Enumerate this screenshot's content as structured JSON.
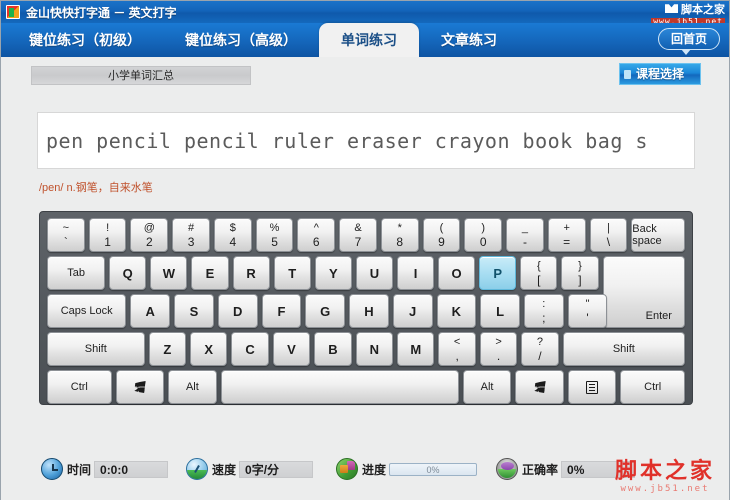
{
  "window": {
    "title": "金山快快打字通 － 英文打字",
    "app_icon": "app-logo-icon"
  },
  "brand": {
    "name": "脚本之家",
    "url": "www.jb51.net"
  },
  "tabs": [
    {
      "label": "键位练习（初级）",
      "active": false
    },
    {
      "label": "键位练习（高级）",
      "active": false
    },
    {
      "label": "单词练习",
      "active": true
    },
    {
      "label": "文章练习",
      "active": false
    }
  ],
  "home_button": {
    "label": "回首页"
  },
  "toolbar": {
    "course_name": "小学单词汇总",
    "course_select_label": "课程选择"
  },
  "typing": {
    "text": "pen pencil pencil ruler eraser crayon book bag s",
    "hint": "/pen/ n.钢笔，自来水笔"
  },
  "keyboard": {
    "highlight_key": "P",
    "highlight_color": "#a9def2",
    "rows": [
      [
        {
          "top": "~",
          "bot": "`"
        },
        {
          "top": "!",
          "bot": "1"
        },
        {
          "top": "@",
          "bot": "2"
        },
        {
          "top": "#",
          "bot": "3"
        },
        {
          "top": "$",
          "bot": "4"
        },
        {
          "top": "%",
          "bot": "5"
        },
        {
          "top": "^",
          "bot": "6"
        },
        {
          "top": "&",
          "bot": "7"
        },
        {
          "top": "*",
          "bot": "8"
        },
        {
          "top": "(",
          "bot": "9"
        },
        {
          "top": ")",
          "bot": "0"
        },
        {
          "top": "_",
          "bot": "-"
        },
        {
          "top": "+",
          "bot": "="
        },
        {
          "top": "|",
          "bot": "\\"
        },
        {
          "label": "Back space"
        }
      ],
      [
        {
          "label": "Tab"
        },
        {
          "label": "Q"
        },
        {
          "label": "W"
        },
        {
          "label": "E"
        },
        {
          "label": "R"
        },
        {
          "label": "T"
        },
        {
          "label": "Y"
        },
        {
          "label": "U"
        },
        {
          "label": "I"
        },
        {
          "label": "O"
        },
        {
          "label": "P"
        },
        {
          "top": "{",
          "bot": "["
        },
        {
          "top": "}",
          "bot": "]"
        },
        {
          "label": "Enter"
        }
      ],
      [
        {
          "label": "Caps Lock"
        },
        {
          "label": "A"
        },
        {
          "label": "S"
        },
        {
          "label": "D"
        },
        {
          "label": "F"
        },
        {
          "label": "G"
        },
        {
          "label": "H"
        },
        {
          "label": "J"
        },
        {
          "label": "K"
        },
        {
          "label": "L"
        },
        {
          "top": ":",
          "bot": ";"
        },
        {
          "top": "\"",
          "bot": "'"
        }
      ],
      [
        {
          "label": "Shift"
        },
        {
          "label": "Z"
        },
        {
          "label": "X"
        },
        {
          "label": "C"
        },
        {
          "label": "V"
        },
        {
          "label": "B"
        },
        {
          "label": "N"
        },
        {
          "label": "M"
        },
        {
          "top": "<",
          "bot": ","
        },
        {
          "top": ">",
          "bot": "."
        },
        {
          "top": "?",
          "bot": "/"
        },
        {
          "label": "Shift"
        }
      ],
      [
        {
          "label": "Ctrl"
        },
        {
          "label": "",
          "icon": "windows-icon"
        },
        {
          "label": "Alt"
        },
        {
          "label": "",
          "icon": "spacebar"
        },
        {
          "label": "Alt"
        },
        {
          "label": "",
          "icon": "windows-icon"
        },
        {
          "label": "",
          "icon": "context-menu-icon"
        },
        {
          "label": "Ctrl"
        }
      ]
    ]
  },
  "status": {
    "time_label": "时间",
    "time_value": "0:0:0",
    "speed_label": "速度",
    "speed_value": "0字/分",
    "progress_label": "进度",
    "progress_value": "0%",
    "progress_percent": 0,
    "accuracy_label": "正确率",
    "accuracy_value": "0%"
  }
}
